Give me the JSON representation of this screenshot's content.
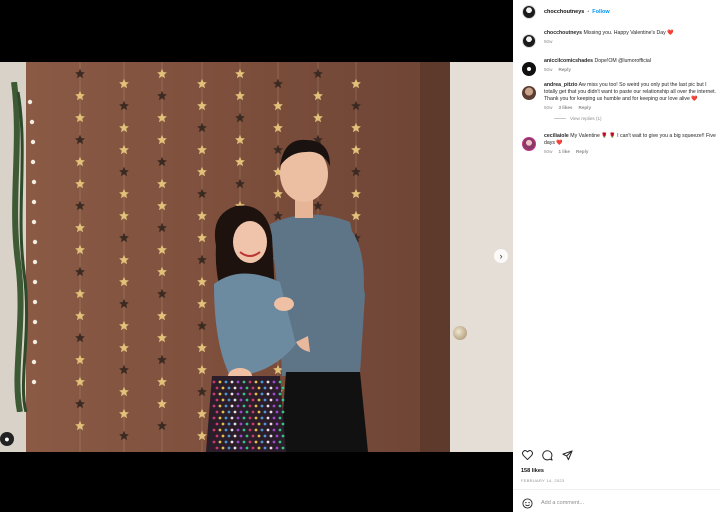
{
  "post": {
    "owner": "chocchoutneys",
    "separator": "•",
    "follow_label": "Follow",
    "likes": "158 likes",
    "date": "FEBRUARY 14, 2023",
    "add_comment_placeholder": "Add a comment..."
  },
  "comments": [
    {
      "user": "chocchoutneys",
      "text": "Missing you. Happy Valentine's Day ❤️",
      "time": "50w",
      "likes": "",
      "reply_label": ""
    },
    {
      "user": "aniccilcomicshades",
      "text": "Dope!OM @lumorofficial",
      "time": "50w",
      "likes": "",
      "reply_label": "Reply"
    },
    {
      "user": "andrea_pitzio",
      "text": "Aw miss you too! So weird you only put the last pic but I totally get that you didn't want to paste our relationship all over the internet. Thank you for keeping us humble and for keeping our love alive ❤️",
      "time": "50w",
      "likes": "3 likes",
      "reply_label": "Reply",
      "view_replies": "View replies (1)"
    },
    {
      "user": "ceciliaiole",
      "text": "My Valentine 🌹 🌹 I can't wait to give you a big squeeze!! Five days ❤️",
      "time": "50w",
      "likes": "1 like",
      "reply_label": "Reply"
    }
  ],
  "icons": {
    "next": "chevron-right-icon",
    "tag": "user-tag-icon",
    "like": "heart-icon",
    "comment": "comment-icon",
    "share": "share-icon",
    "emoji": "emoji-icon"
  }
}
